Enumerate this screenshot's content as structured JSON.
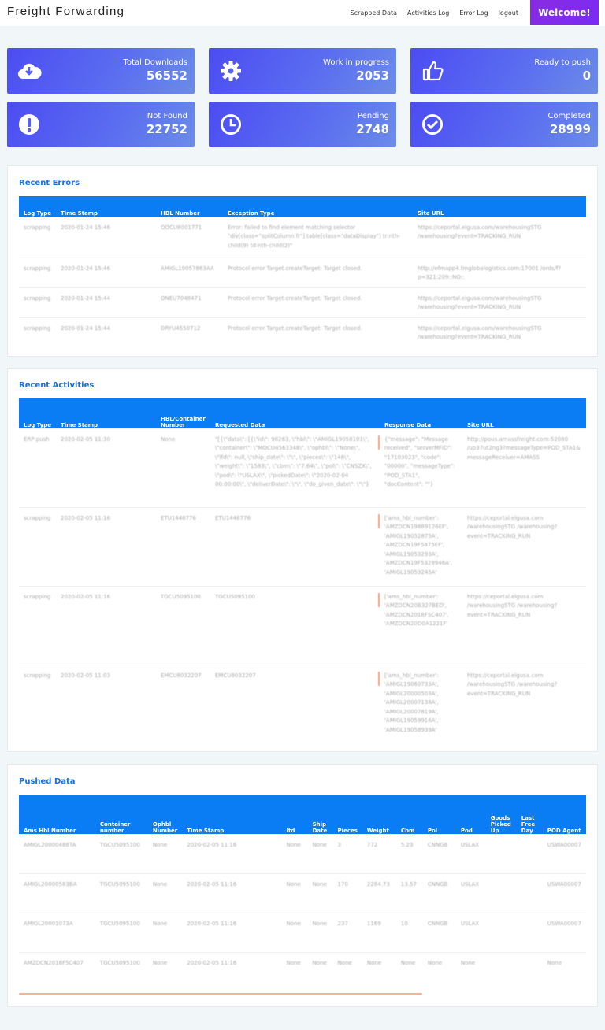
{
  "app": {
    "title": "Freight Forwarding"
  },
  "nav": {
    "links": [
      "Scrapped Data",
      "Activities Log",
      "Error Log",
      "logout"
    ],
    "welcome": "Welcome!"
  },
  "stats": [
    {
      "icon": "cloud-download-icon",
      "label": "Total Downloads",
      "value": "56552"
    },
    {
      "icon": "gear-icon",
      "label": "Work in progress",
      "value": "2053"
    },
    {
      "icon": "thumbs-up-icon",
      "label": "Ready to push",
      "value": "0"
    },
    {
      "icon": "exclamation-circle-icon",
      "label": "Not Found",
      "value": "22752"
    },
    {
      "icon": "clock-icon",
      "label": "Pending",
      "value": "2748"
    },
    {
      "icon": "check-circle-icon",
      "label": "Completed",
      "value": "28999"
    }
  ],
  "errors": {
    "title": "Recent Errors",
    "columns": [
      "Log Type",
      "Time Stamp",
      "HBL Number",
      "Exception Type",
      "Site URL"
    ],
    "rows": [
      [
        "scrapping",
        "2020-01-24 15:46",
        "OOCU8001771",
        "Error: failed to find element matching selector \"div[class=\"splitColumn fr\"] table[class=\"dataDisplay\"] tr:nth-child(9) td:nth-child(2)\"",
        "https://ceportal.elgusa.com/warehousingSTG /warehousing?event=TRACKING_RUN"
      ],
      [
        "scrapping",
        "2020-01-24 15:46",
        "AMIGL19057863AA",
        "Protocol error Target.createTarget: Target closed.",
        "http://efmapp4.fmglobalogistics.com:17001 /ords/f?p=321:209::NO::"
      ],
      [
        "scrapping",
        "2020-01-24 15:44",
        "ONEU7048471",
        "Protocol error Target.createTarget: Target closed.",
        "https://ceportal.elgusa.com/warehousingSTG /warehousing?event=TRACKING_RUN"
      ],
      [
        "scrapping",
        "2020-01-24 15:44",
        "DRYU4550712",
        "Protocol error Target.createTarget: Target closed.",
        "https://ceportal.elgusa.com/warehousingSTG /warehousing?event=TRACKING_RUN"
      ]
    ]
  },
  "activities": {
    "title": "Recent Activities",
    "columns": [
      "Log Type",
      "Time Stamp",
      "HBL/Container Number",
      "Requested Data",
      "Response Data",
      "Site URL"
    ],
    "rows": [
      [
        "ERP push",
        "2020-02-05 11:30",
        "None",
        "\"[{\\\"data\\\": [{\\\"id\\\": 98263, \\\"hbl\\\": \\\"AMIGL19058101\\\", \\\"container\\\": \\\"MOCU4563348\\\", \\\"ophbl\\\": \\\"None\\\", \\\"lfd\\\": null, \\\"ship_date\\\": \\\"\\\", \\\"pieces\\\": \\\"148\\\", \\\"weight\\\": \\\"1583\\\", \\\"cbm\\\": \\\"7.64\\\", \\\"pol\\\": \\\"CNSZX\\\", \\\"pod\\\": \\\"USLAX\\\", \\\"pickedDate\\\": \\\"2020-02-04 00:00:00\\\", \\\"deliverDate\\\": \\\"\\\", \\\"do_given_date\\\": \\\"\\\"}",
        "{\"message\": \"Message received\", \"serverMFID\": \"17103023\", \"code\": \"00000\", \"messageType\": \"POD_STA1\", \"docContent\": \"\"}",
        "http://pous.amassfreight.com:52080 /up37ut2ng3?messageType=POD_STA1& messageReceiver=AMASS"
      ],
      [
        "scrapping",
        "2020-02-05 11:16",
        "ETU1448776",
        "ETU1448776",
        "['ams_hbl_number': 'AMZDCN19889126EF', 'AMIGL19052875A', 'AMZDCN19F5875EF', 'AMIGL19053293A', 'AMZDCN19F5328946A', 'AMIGL19053245A'",
        "https://ceportal.elgusa.com /warehousingSTG /warehousing?event=TRACKING_RUN"
      ],
      [
        "scrapping",
        "2020-02-05 11:16",
        "TGCU5095100",
        "TGCU5095100",
        "['ams_hbl_number': 'AMZDCN20B327BED', 'AMZDCN2018F5C407', 'AMZDCN20D0A1221F'",
        "https://ceportal.elgusa.com /warehousingSTG /warehousing?event=TRACKING_RUN"
      ],
      [
        "scrapping",
        "2020-02-05 11:03",
        "EMCU8032207",
        "EMCU8032207",
        "['ams_hbl_number': 'AMIGL19060733A', 'AMIGL20000503A', 'AMIGL20007138A', 'AMIGL20007819A', 'AMIGL19059916A', 'AMIGL19058939A'",
        "https://ceportal.elgusa.com /warehousingSTG /warehousing?event=TRACKING_RUN"
      ]
    ]
  },
  "pushed": {
    "title": "Pushed Data",
    "columns": [
      "Ams Hbl Number",
      "Container number",
      "Ophbl Number",
      "Time Stamp",
      "ltd",
      "Ship Date",
      "Pieces",
      "Weight",
      "Cbm",
      "Pol",
      "Pod",
      "Goods Picked Up",
      "Last Free Day",
      "POD Agent"
    ],
    "rows": [
      [
        "AMIGL20000488TA",
        "TGCU5095100",
        "None",
        "2020-02-05 11:16",
        "None",
        "None",
        "3",
        "772",
        "5.23",
        "CNNGB",
        "USLAX",
        "",
        "",
        "USWA00007"
      ],
      [
        "AMIGL20000583BA",
        "TGCU5095100",
        "None",
        "2020-02-05 11:16",
        "None",
        "None",
        "170",
        "2284.73",
        "13.57",
        "CNNGB",
        "USLAX",
        "",
        "",
        "USWA00007"
      ],
      [
        "AMIGL20001073A",
        "TGCU5095100",
        "None",
        "2020-02-05 11:16",
        "None",
        "None",
        "237",
        "1169",
        "10",
        "CNNGB",
        "USLAX",
        "",
        "",
        "USWA00007"
      ],
      [
        "AMZDCN2018F5C407",
        "TGCU5095100",
        "None",
        "2020-02-05 11:16",
        "None",
        "None",
        "None",
        "None",
        "None",
        "None",
        "None",
        "",
        "",
        "None"
      ]
    ]
  }
}
